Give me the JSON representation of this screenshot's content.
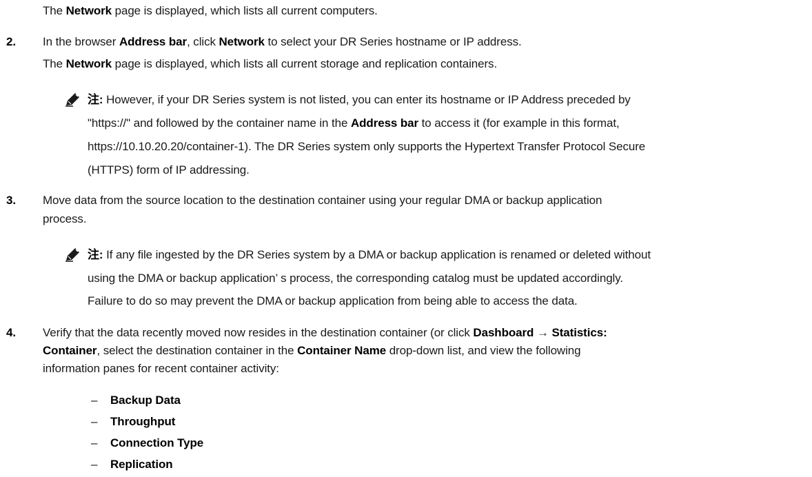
{
  "intro": {
    "t1": "The ",
    "b1": "Network",
    "t2": " page is displayed, which lists all current computers."
  },
  "step2": {
    "number": "2.",
    "t1": "In the browser ",
    "b1": "Address bar",
    "t2": ", click ",
    "b2": "Network",
    "t3": " to select your DR Series hostname or IP address.",
    "r_t1": "The ",
    "r_b1": "Network",
    "r_t2": " page is displayed, which lists all current storage and replication containers."
  },
  "note1": {
    "icon": "note-pencil-icon",
    "label": "注:",
    "l1": " However, if your DR Series system is not listed, you can enter its hostname or IP Address preceded by",
    "l2a": "\"https://\" and followed by the container name in the ",
    "l2b": "Address bar",
    "l2c": " to access it (for example in this format,",
    "l3": "https://10.10.20.20/container-1). The DR Series system only supports the Hypertext Transfer Protocol Secure",
    "l4": "(HTTPS) form of IP addressing."
  },
  "step3": {
    "number": "3.",
    "l1": "Move data from the source location to the destination container using your regular DMA or backup application",
    "l2": "process."
  },
  "note2": {
    "icon": "note-pencil-icon",
    "label": "注:",
    "l1": " If any file ingested by the DR Series system by a DMA or backup application is renamed or deleted without",
    "l2": "using the DMA or backup application’ s process, the corresponding catalog must be updated accordingly.",
    "l3": "Failure to do so may prevent the DMA or backup application from being able to access the data."
  },
  "step4": {
    "number": "4.",
    "l1a": "Verify that the data recently moved now resides in the destination container (or click ",
    "l1b": "Dashboard",
    "l1c": " → ",
    "l1d": "Statistics:",
    "l2a": "Container",
    "l2b": ", select the destination container in the ",
    "l2c": "Container Name",
    "l2d": " drop-down list, and view the following",
    "l3": "information panes for recent container activity:"
  },
  "panes": {
    "dash": "–",
    "items": [
      "Backup Data",
      "Throughput",
      "Connection Type",
      "Replication"
    ]
  }
}
